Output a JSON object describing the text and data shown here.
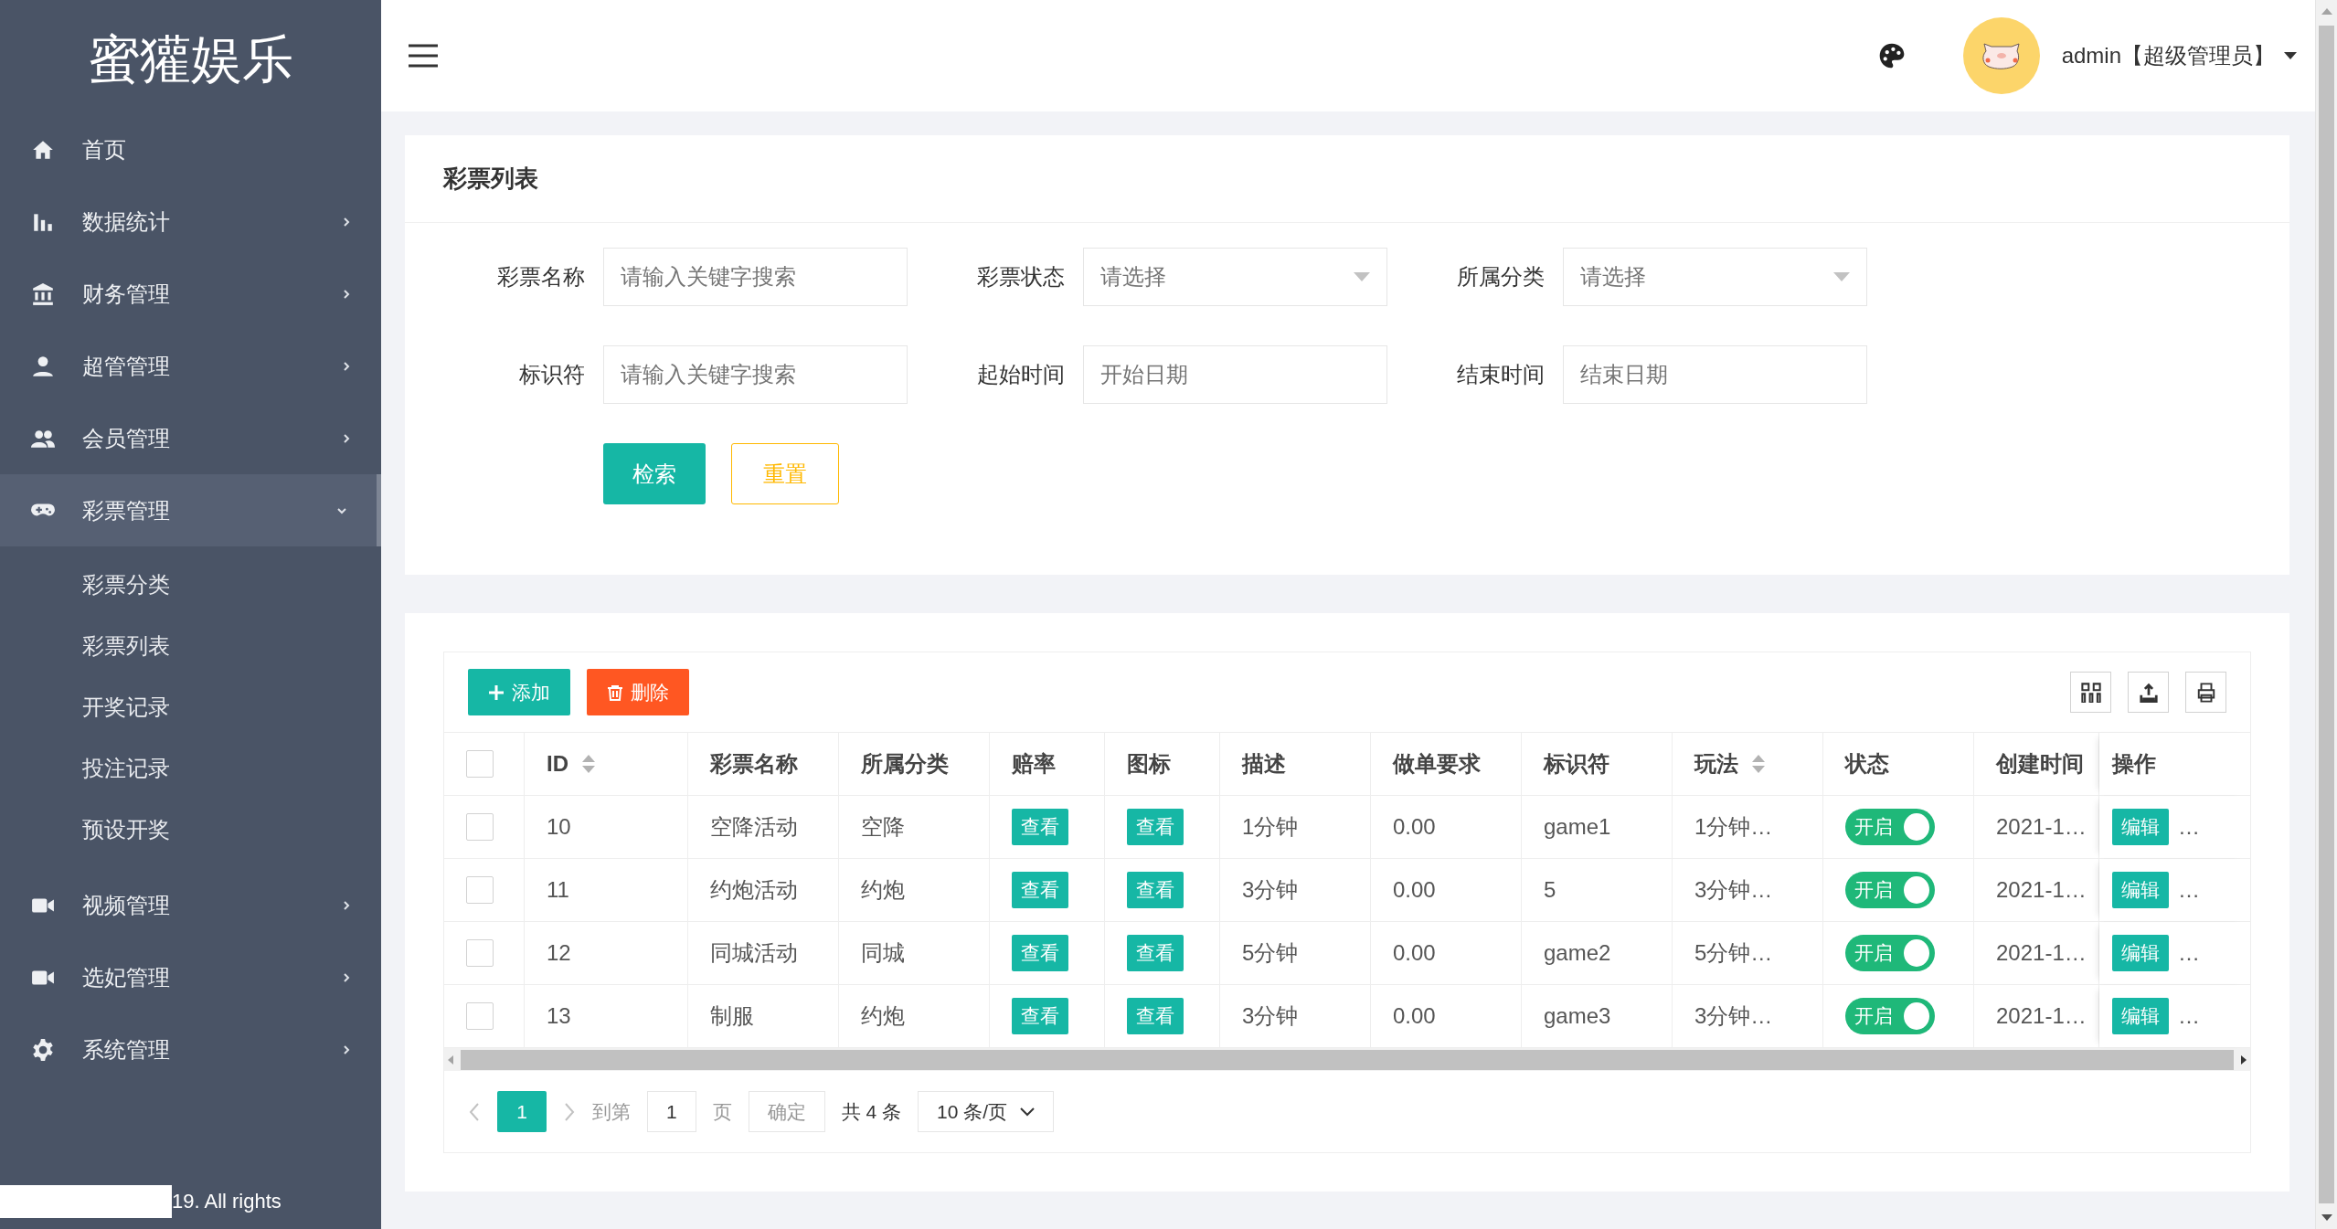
{
  "sidebar": {
    "logo": "蜜獾娱乐",
    "items": [
      {
        "label": "首页",
        "has_children": false,
        "expanded": false
      },
      {
        "label": "数据统计",
        "has_children": true,
        "expanded": false
      },
      {
        "label": "财务管理",
        "has_children": true,
        "expanded": false
      },
      {
        "label": "超管管理",
        "has_children": true,
        "expanded": false
      },
      {
        "label": "会员管理",
        "has_children": true,
        "expanded": false
      },
      {
        "label": "彩票管理",
        "has_children": true,
        "expanded": true,
        "children": [
          {
            "label": "彩票分类"
          },
          {
            "label": "彩票列表"
          },
          {
            "label": "开奖记录"
          },
          {
            "label": "投注记录"
          },
          {
            "label": "预设开奖"
          }
        ]
      },
      {
        "label": "视频管理",
        "has_children": true,
        "expanded": false
      },
      {
        "label": "选妃管理",
        "has_children": true,
        "expanded": false
      },
      {
        "label": "系统管理",
        "has_children": true,
        "expanded": false
      }
    ],
    "footer": "19. All rights"
  },
  "header": {
    "user_label": "admin【超级管理员】"
  },
  "filter": {
    "title": "彩票列表",
    "fields": [
      {
        "label": "彩票名称",
        "kind": "text",
        "placeholder": "请输入关键字搜索"
      },
      {
        "label": "彩票状态",
        "kind": "select",
        "placeholder": "请选择"
      },
      {
        "label": "所属分类",
        "kind": "select",
        "placeholder": "请选择"
      },
      {
        "label": "标识符",
        "kind": "text",
        "placeholder": "请输入关键字搜索"
      },
      {
        "label": "起始时间",
        "kind": "text",
        "placeholder": "开始日期"
      },
      {
        "label": "结束时间",
        "kind": "text",
        "placeholder": "结束日期"
      }
    ],
    "buttons": [
      {
        "label": "检索",
        "kind": "primary"
      },
      {
        "label": "重置",
        "kind": "outline"
      }
    ]
  },
  "table": {
    "toolbar": [
      {
        "label": "添加",
        "kind": "add"
      },
      {
        "label": "删除",
        "kind": "delete"
      }
    ],
    "header_checked": false,
    "columns": [
      {
        "label": "ID",
        "sortable": true
      },
      {
        "label": "彩票名称",
        "sortable": false
      },
      {
        "label": "所属分类",
        "sortable": false
      },
      {
        "label": "赔率",
        "sortable": false
      },
      {
        "label": "图标",
        "sortable": false
      },
      {
        "label": "描述",
        "sortable": false
      },
      {
        "label": "做单要求",
        "sortable": false
      },
      {
        "label": "标识符",
        "sortable": false
      },
      {
        "label": "玩法",
        "sortable": true
      },
      {
        "label": "状态",
        "sortable": false
      },
      {
        "label": "创建时间",
        "sortable": false
      },
      {
        "label": "操作",
        "sortable": false
      }
    ],
    "rows": [
      {
        "checked": false,
        "id": "10",
        "name": "空降活动",
        "category": "空降",
        "odds": "查看",
        "icon": "查看",
        "desc": "1分钟",
        "requirement": "0.00",
        "identifier": "game1",
        "play": "1分钟…",
        "status": {
          "label": "开启",
          "on": true
        },
        "created": "2021-1…",
        "edit": "编辑",
        "more": "…"
      },
      {
        "checked": false,
        "id": "11",
        "name": "约炮活动",
        "category": "约炮",
        "odds": "查看",
        "icon": "查看",
        "desc": "3分钟",
        "requirement": "0.00",
        "identifier": "5",
        "play": "3分钟…",
        "status": {
          "label": "开启",
          "on": true
        },
        "created": "2021-1…",
        "edit": "编辑",
        "more": "…"
      },
      {
        "checked": false,
        "id": "12",
        "name": "同城活动",
        "category": "同城",
        "odds": "查看",
        "icon": "查看",
        "desc": "5分钟",
        "requirement": "0.00",
        "identifier": "game2",
        "play": "5分钟…",
        "status": {
          "label": "开启",
          "on": true
        },
        "created": "2021-1…",
        "edit": "编辑",
        "more": "…"
      },
      {
        "checked": false,
        "id": "13",
        "name": "制服",
        "category": "约炮",
        "odds": "查看",
        "icon": "查看",
        "desc": "3分钟",
        "requirement": "0.00",
        "identifier": "game3",
        "play": "3分钟…",
        "status": {
          "label": "开启",
          "on": true
        },
        "created": "2021-1…",
        "edit": "编辑",
        "more": "…"
      }
    ]
  },
  "pagination": {
    "pages": [
      {
        "label": "1",
        "selected": true
      }
    ],
    "goto_label": "到第",
    "goto_value": "1",
    "page_unit": "页",
    "confirm": "确定",
    "total": "共 4 条",
    "page_size": "10 条/页"
  }
}
